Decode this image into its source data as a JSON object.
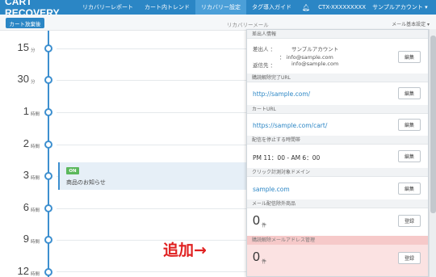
{
  "app": {
    "brand": "CART RECOVERY"
  },
  "nav": {
    "items": [
      {
        "label": "リカバリーレポート"
      },
      {
        "label": "カート内トレンド"
      },
      {
        "label": "リカバリー設定"
      },
      {
        "label": "タグ導入ガイド"
      }
    ],
    "bell_icon": "bell-icon",
    "account_id": "CTX-XXXXXXXXX",
    "account_name": "サンプルアカウント ▾"
  },
  "subbar": {
    "cart_button": "カート放棄後",
    "title": "リカバリーメール",
    "settings_link": "メール基本設定 ▾"
  },
  "timeline": {
    "rows": [
      {
        "num": "15",
        "unit": "分"
      },
      {
        "num": "30",
        "unit": "分"
      },
      {
        "num": "1",
        "unit": "時間"
      },
      {
        "num": "2",
        "unit": "時間"
      },
      {
        "num": "3",
        "unit": "時間"
      },
      {
        "num": "6",
        "unit": "時間"
      },
      {
        "num": "9",
        "unit": "時間"
      },
      {
        "num": "12",
        "unit": "時間"
      }
    ],
    "card": {
      "badge": "ON",
      "label": "商品のお知らせ"
    }
  },
  "panel": {
    "sender": {
      "header": "差出人情報",
      "from_label": "差出人 ：",
      "from_name": "サンプルアカウント",
      "from_email": "： info@sample.com",
      "reply_label": "返信先 ：",
      "reply_email": "info@sample.com",
      "button": "編集"
    },
    "unsubscribe_url": {
      "header": "購読解除完了URL",
      "value": "http://sample.com/",
      "button": "編集"
    },
    "cart_url": {
      "header": "カートURL",
      "value": "https://sample.com/cart/",
      "button": "編集"
    },
    "stop_time": {
      "header": "配信を停止する時間帯",
      "value": "PM 11：00 - AM 6：00",
      "button": "編集"
    },
    "click_domain": {
      "header": "クリック計測対象ドメイン",
      "value": "sample.com",
      "button": "編集"
    },
    "excluded_products": {
      "header": "メール配信除外商品",
      "count": "0",
      "unit": "件",
      "button": "登録"
    },
    "unsub_addresses": {
      "header": "購読解除メールアドレス管理",
      "count": "0",
      "unit": "件",
      "button": "登録"
    }
  },
  "annotation": "追加→",
  "colors": {
    "brand_blue": "#2b86c5",
    "highlight_red": "#f6c9c9",
    "annotation_red": "#e02020",
    "on_green": "#5cb85c"
  }
}
